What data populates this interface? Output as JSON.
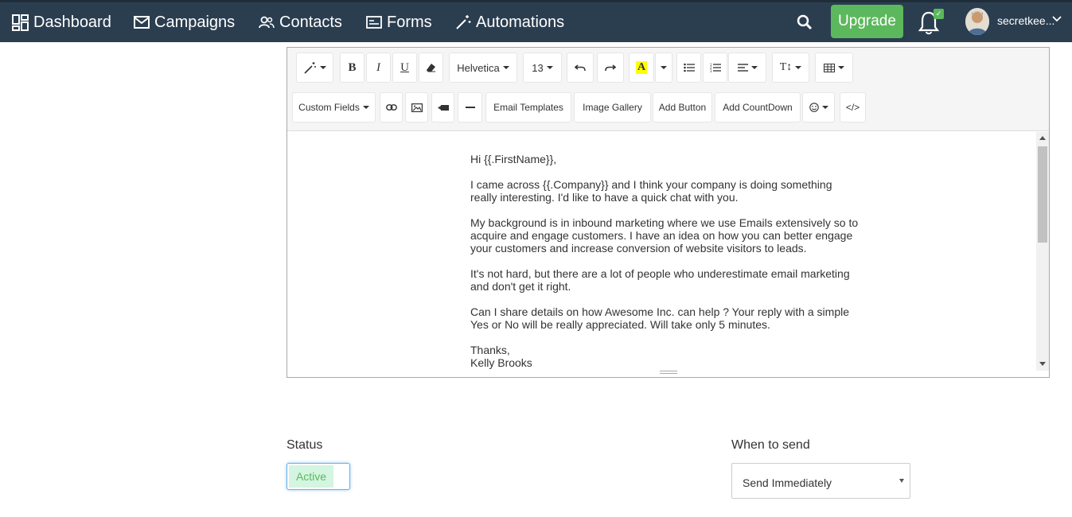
{
  "nav": {
    "items": [
      {
        "label": "Dashboard",
        "icon": "dashboard-icon"
      },
      {
        "label": "Campaigns",
        "icon": "envelope-icon"
      },
      {
        "label": "Contacts",
        "icon": "users-icon"
      },
      {
        "label": "Forms",
        "icon": "form-icon"
      },
      {
        "label": "Automations",
        "icon": "magic-wand-icon"
      }
    ],
    "upgrade_label": "Upgrade",
    "notification_badge": "✓",
    "username": "secretkee..."
  },
  "toolbar": {
    "font_family": "Helvetica",
    "font_size": "13",
    "custom_fields_label": "Custom Fields",
    "email_templates_label": "Email Templates",
    "image_gallery_label": "Image Gallery",
    "add_button_label": "Add Button",
    "add_countdown_label": "Add CountDown",
    "code_view_label": "</>",
    "highlight_letter": "A",
    "bold": "B",
    "italic": "I",
    "underline": "U",
    "text_size_icon": "T↕"
  },
  "email": {
    "greeting": "Hi {{.FirstName}},",
    "paragraph1": "I came across {{.Company}} and I think your company is doing something really interesting. I'd like to have a quick chat with you.",
    "paragraph2": "My background is in inbound marketing where we use Emails extensively so to acquire and engage customers. I have an idea on how you can better engage your customers and increase conversion of website visitors to leads.",
    "paragraph3": "It's not hard, but there are a lot of people who underestimate email marketing and don't get it right.",
    "paragraph4": "Can I share details on how Awesome Inc. can help ? Your reply with a simple Yes or No will be really appreciated. Will take only 5 minutes.",
    "signoff": "Thanks,",
    "signature": "Kelly Brooks"
  },
  "settings": {
    "status_label": "Status",
    "status_value": "Active",
    "when_label": "When to send",
    "when_value": "Send Immediately"
  },
  "colors": {
    "navbar": "#2b3e50",
    "upgrade": "#5cb85c",
    "active_bg": "#d4f5e1"
  }
}
